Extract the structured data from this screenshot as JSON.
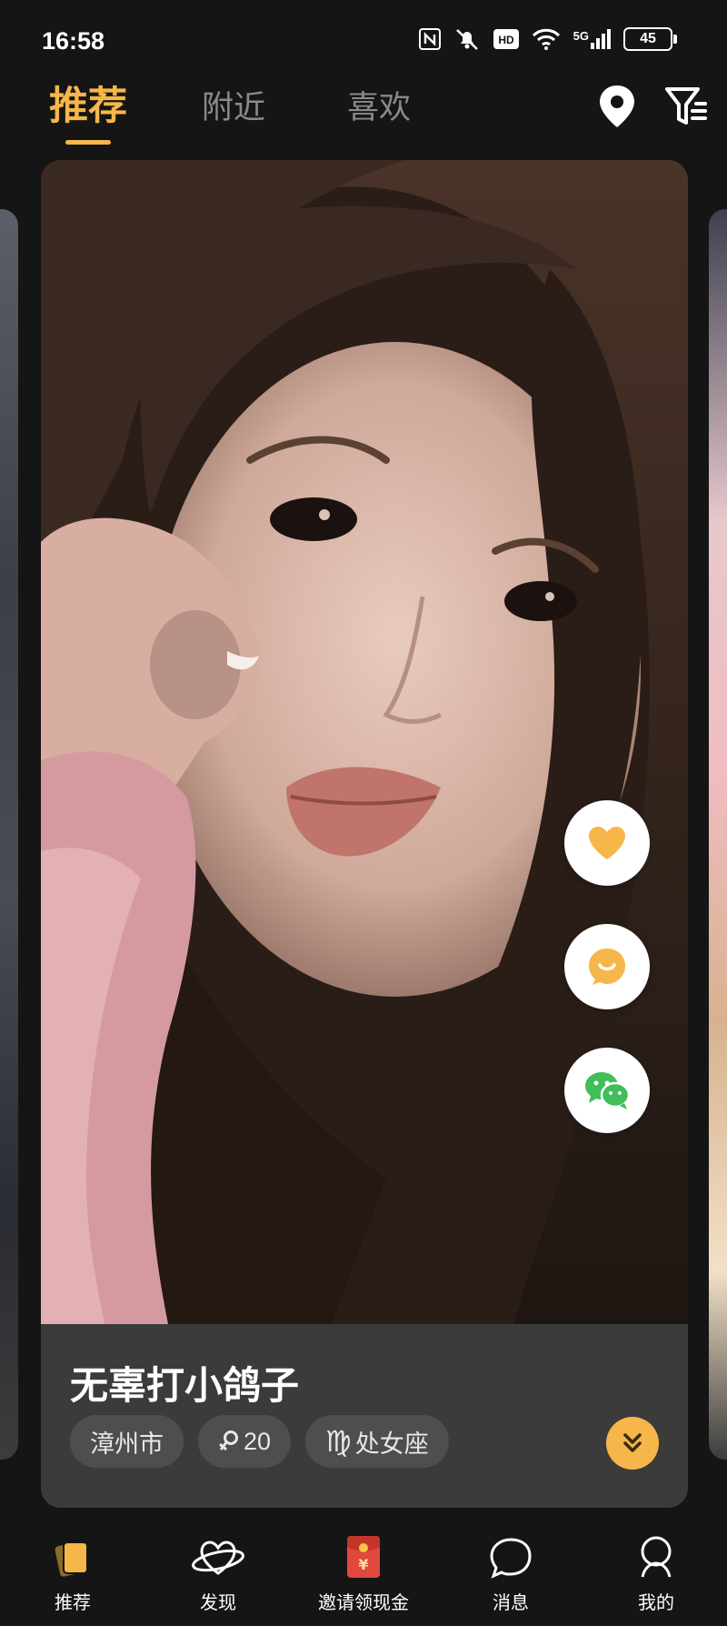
{
  "status_bar": {
    "time": "16:58",
    "network": "5G",
    "battery": "45",
    "icons": [
      "nfc-icon",
      "mute-icon",
      "hd-icon",
      "wifi-icon",
      "signal-icon",
      "battery-icon"
    ]
  },
  "top_tabs": [
    {
      "label": "推荐",
      "active": true
    },
    {
      "label": "附近",
      "active": false
    },
    {
      "label": "喜欢",
      "active": false
    }
  ],
  "top_actions": [
    "location-pin-icon",
    "filter-icon"
  ],
  "profile": {
    "nickname": "无辜打小鸽子",
    "tags": {
      "city": "漳州市",
      "age": "20",
      "zodiac": "处女座",
      "zodiac_symbol": "♍"
    }
  },
  "actions": [
    "heart-icon",
    "smile-chat-icon",
    "wechat-icon"
  ],
  "colors": {
    "accent": "#f6b64a",
    "background": "#151515",
    "card_info": "#3b3b3b",
    "wechat": "#3fbe5a"
  },
  "bottom_nav": [
    {
      "label": "推荐",
      "icon": "cards-icon"
    },
    {
      "label": "发现",
      "icon": "planet-heart-icon"
    },
    {
      "label": "邀请领现金",
      "icon": "red-envelope-icon"
    },
    {
      "label": "消息",
      "icon": "chat-bubble-icon"
    },
    {
      "label": "我的",
      "icon": "profile-icon"
    }
  ]
}
